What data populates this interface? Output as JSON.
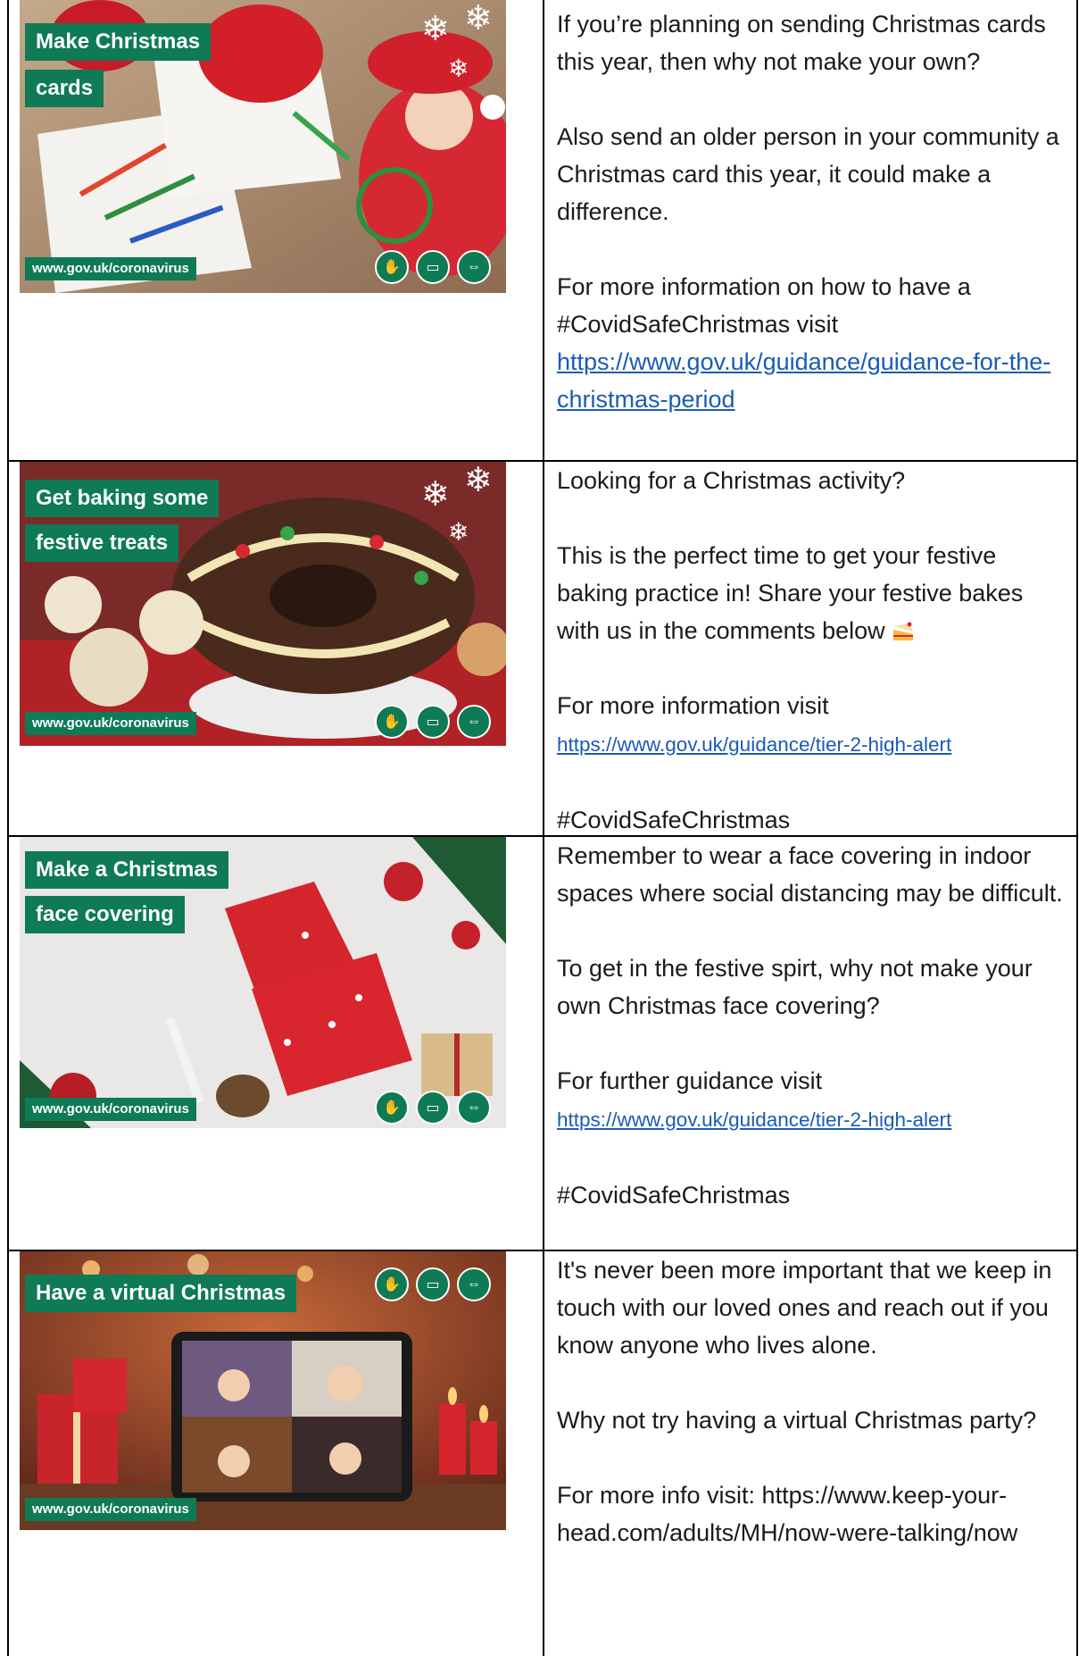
{
  "rows": [
    {
      "banner_lines": [
        "Make Christmas",
        "cards"
      ],
      "url": "www.gov.uk/coronavirus",
      "paragraphs": [
        "If you’re planning on sending Christmas cards this year, then why not make your own?",
        "Also send an older person in your community a Christmas card this year, it could make a difference.",
        "For more information on how to have a #CovidSafeChristmas visit"
      ],
      "link": "https://www.gov.uk/guidance/guidance-for-the-christmas-period"
    },
    {
      "banner_lines": [
        "Get baking some",
        "festive treats"
      ],
      "url": "www.gov.uk/coronavirus",
      "paragraphs": [
        "Looking for a Christmas activity?",
        "This is the perfect time to get your festive baking practice in! Share your festive bakes with us in the comments below",
        "For more information visit"
      ],
      "link": "https://www.gov.uk/guidance/tier-2-high-alert",
      "hashtag": "#CovidSafeChristmas"
    },
    {
      "banner_lines": [
        "Make a Christmas",
        "face covering"
      ],
      "url": "www.gov.uk/coronavirus",
      "paragraphs": [
        "Remember to wear a face covering in indoor spaces where social distancing may be difficult.",
        "To get in the festive spirt, why not make your own Christmas face covering?",
        "For further guidance visit"
      ],
      "link": "https://www.gov.uk/guidance/tier-2-high-alert",
      "hashtag": "#CovidSafeChristmas"
    },
    {
      "banner_lines": [
        "Have a virtual Christmas"
      ],
      "url": "www.gov.uk/coronavirus",
      "paragraphs": [
        "It's never been more important that we keep in touch with our loved ones and reach out if you know anyone who lives alone.",
        "Why not try having a virtual Christmas party?",
        "For more info visit: https://www.keep-your-head.com/adults/MH/now-were-talking/now"
      ]
    }
  ],
  "icons": [
    "hand-wash-icon",
    "face-mask-icon",
    "social-distance-icon"
  ],
  "colors": {
    "gov_green": "#0e7a56",
    "link_blue": "#1a5bb5"
  }
}
